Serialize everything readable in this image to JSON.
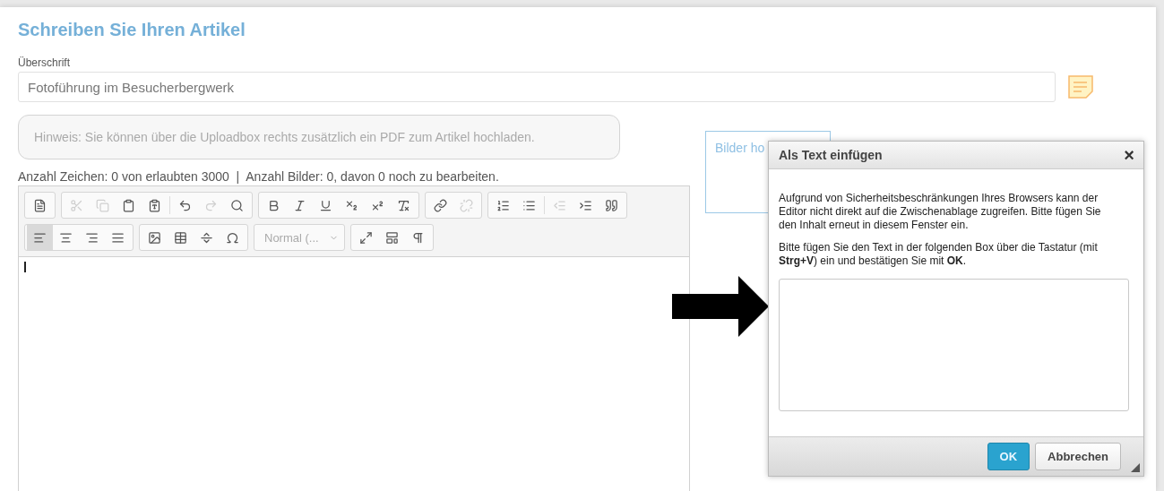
{
  "page": {
    "title": "Schreiben Sie Ihren Artikel"
  },
  "headline": {
    "label": "Überschrift",
    "value": "Fotoführung im Besucherbergwerk"
  },
  "hint": "Hinweis: Sie können über die Uploadbox rechts zusätzlich ein PDF zum Artikel hochladen.",
  "counter": "Anzahl Zeichen: 0 von erlaubten 3000  |  Anzahl Bilder: 0, davon 0 noch zu bearbeiten.",
  "toolbar": {
    "rows": [
      [
        {
          "kind": "buttons",
          "items": [
            {
              "kind": "source",
              "disabled": false,
              "selected": false
            }
          ]
        },
        {
          "kind": "buttons",
          "items": [
            {
              "kind": "cut",
              "disabled": true,
              "selected": false
            },
            {
              "kind": "copy",
              "disabled": true,
              "selected": false
            },
            {
              "kind": "paste",
              "disabled": false,
              "selected": false
            },
            {
              "kind": "paste-text",
              "disabled": false,
              "selected": false
            },
            {
              "kind": "separator"
            },
            {
              "kind": "undo",
              "disabled": false,
              "selected": false
            },
            {
              "kind": "redo",
              "disabled": true,
              "selected": false
            },
            {
              "kind": "find",
              "disabled": false,
              "selected": false
            }
          ]
        },
        {
          "kind": "buttons",
          "items": [
            {
              "kind": "bold",
              "disabled": false,
              "selected": false
            },
            {
              "kind": "italic",
              "disabled": false,
              "selected": false
            },
            {
              "kind": "underline",
              "disabled": false,
              "selected": false
            },
            {
              "kind": "subscript",
              "disabled": false,
              "selected": false
            },
            {
              "kind": "superscript",
              "disabled": false,
              "selected": false
            },
            {
              "kind": "remove-format",
              "disabled": false,
              "selected": false
            }
          ]
        },
        {
          "kind": "buttons",
          "items": [
            {
              "kind": "link",
              "disabled": false,
              "selected": false
            },
            {
              "kind": "unlink",
              "disabled": true,
              "selected": false
            }
          ]
        },
        {
          "kind": "buttons",
          "items": [
            {
              "kind": "numbered-list",
              "disabled": false,
              "selected": false
            },
            {
              "kind": "bulleted-list",
              "disabled": false,
              "selected": false
            },
            {
              "kind": "separator"
            },
            {
              "kind": "outdent",
              "disabled": true,
              "selected": false
            },
            {
              "kind": "indent",
              "disabled": false,
              "selected": false
            },
            {
              "kind": "blockquote",
              "disabled": false,
              "selected": false
            }
          ]
        }
      ],
      [
        {
          "kind": "buttons",
          "items": [
            {
              "kind": "align-left",
              "disabled": false,
              "selected": true
            },
            {
              "kind": "align-center",
              "disabled": false,
              "selected": false
            },
            {
              "kind": "align-right",
              "disabled": false,
              "selected": false
            },
            {
              "kind": "justify",
              "disabled": false,
              "selected": false
            }
          ]
        },
        {
          "kind": "buttons",
          "items": [
            {
              "kind": "image",
              "disabled": false,
              "selected": false
            },
            {
              "kind": "table",
              "disabled": false,
              "selected": false
            },
            {
              "kind": "horizontal-rule",
              "disabled": false,
              "selected": false
            },
            {
              "kind": "special-char",
              "disabled": false,
              "selected": false
            }
          ]
        },
        {
          "kind": "dropdown",
          "value": "Normal (..."
        },
        {
          "kind": "buttons",
          "items": [
            {
              "kind": "maximize",
              "disabled": false,
              "selected": false
            },
            {
              "kind": "show-blocks",
              "disabled": false,
              "selected": false
            },
            {
              "kind": "paragraph-marks",
              "disabled": false,
              "selected": false
            }
          ]
        }
      ]
    ]
  },
  "upload": {
    "label": "Bilder ho"
  },
  "dialog": {
    "title": "Als Text einfügen",
    "close": "×",
    "paragraphs": [
      "Aufgrund von Sicherheitsbeschränkungen Ihres Browsers kann der Editor nicht direkt auf die Zwischenablage zugreifen. Bitte fügen Sie den Inhalt erneut in diesem Fenster ein.",
      "Bitte fügen Sie den Text in der folgenden Box über die Tastatur (mit **Strg+V**) ein und bestätigen Sie mit **OK**."
    ],
    "buttons": [
      {
        "label": "OK",
        "kind": "primary"
      },
      {
        "label": "Abbrechen",
        "kind": "secondary"
      }
    ]
  }
}
